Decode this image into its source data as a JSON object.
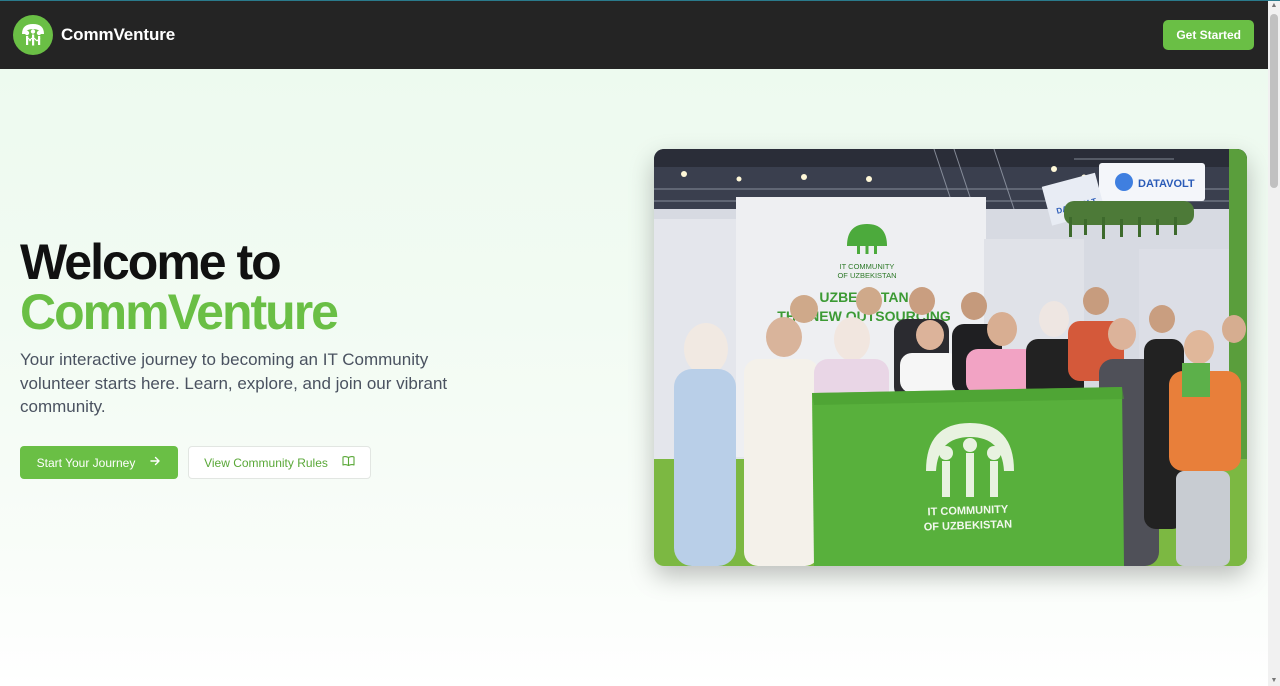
{
  "header": {
    "brand_name": "CommVenture",
    "cta_label": "Get Started"
  },
  "hero": {
    "title_line1": "Welcome to",
    "title_line2": "CommVenture",
    "subtitle": "Your interactive journey to becoming an IT Community volunteer starts here. Learn, explore, and join our vibrant community.",
    "primary_button": "Start Your Journey",
    "secondary_button": "View Community Rules"
  },
  "photo": {
    "sign_text_1": "IT COMMUNITY",
    "sign_text_2": "OF UZBEKISTAN",
    "banner_text": "UZBEKISTAN",
    "banner_text_2": "THE NEW OUTSOURCING",
    "sponsor_1": "DATAVOLT",
    "sponsor_2": "DATAVOLT",
    "flag_line_1": "IT COMMUNITY",
    "flag_line_2": "OF UZBEKISTAN"
  },
  "icons": {
    "logo": "tree-people-logo-icon",
    "arrow": "arrow-right-icon",
    "book": "book-open-icon"
  },
  "colors": {
    "accent": "#6abf45",
    "header_bg": "#242424",
    "text_dark": "#111111",
    "text_body": "#4a5260"
  }
}
